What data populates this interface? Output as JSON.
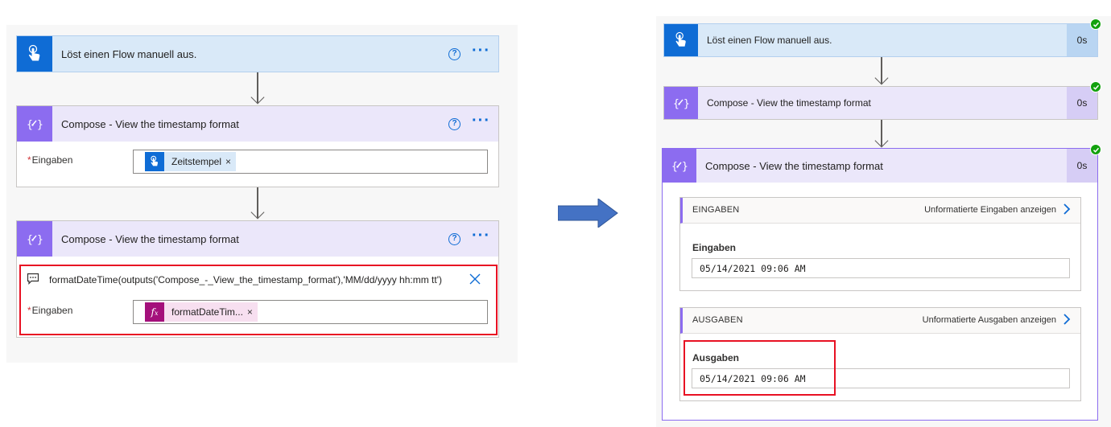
{
  "left": {
    "trigger_card": {
      "title": "Löst einen Flow manuell aus."
    },
    "compose1": {
      "title": "Compose - View the timestamp format",
      "field_label": "Eingaben",
      "token_text": "Zeitstempel",
      "token_remove": "×"
    },
    "compose2": {
      "title": "Compose - View the timestamp format",
      "expression": "formatDateTime(outputs('Compose_-_View_the_timestamp_format'),'MM/dd/yyyy hh:mm tt')",
      "field_label": "Eingaben",
      "token_text": "formatDateTim...",
      "token_remove": "×"
    },
    "help_icon": "?",
    "more_icon": "···",
    "required_mark": "*"
  },
  "right": {
    "trigger_card": {
      "title": "Löst einen Flow manuell aus.",
      "duration": "0s"
    },
    "compose1": {
      "title": "Compose - View the timestamp format",
      "duration": "0s"
    },
    "compose2": {
      "title": "Compose - View the timestamp format",
      "duration": "0s",
      "inputs_section": {
        "header": "EINGABEN",
        "link": "Unformatierte Eingaben anzeigen",
        "label": "Eingaben",
        "value": "05/14/2021 09:06 AM"
      },
      "outputs_section": {
        "header": "AUSGABEN",
        "link": "Unformatierte Ausgaben anzeigen",
        "label": "Ausgaben",
        "value": "05/14/2021 09:06 AM"
      }
    }
  },
  "colors": {
    "trigger_blue": "#0f6cd5",
    "compose_purple": "#8c6cf0",
    "success_green": "#13a10e",
    "highlight_red": "#e81123",
    "arrow_blue": "#4472c4"
  }
}
